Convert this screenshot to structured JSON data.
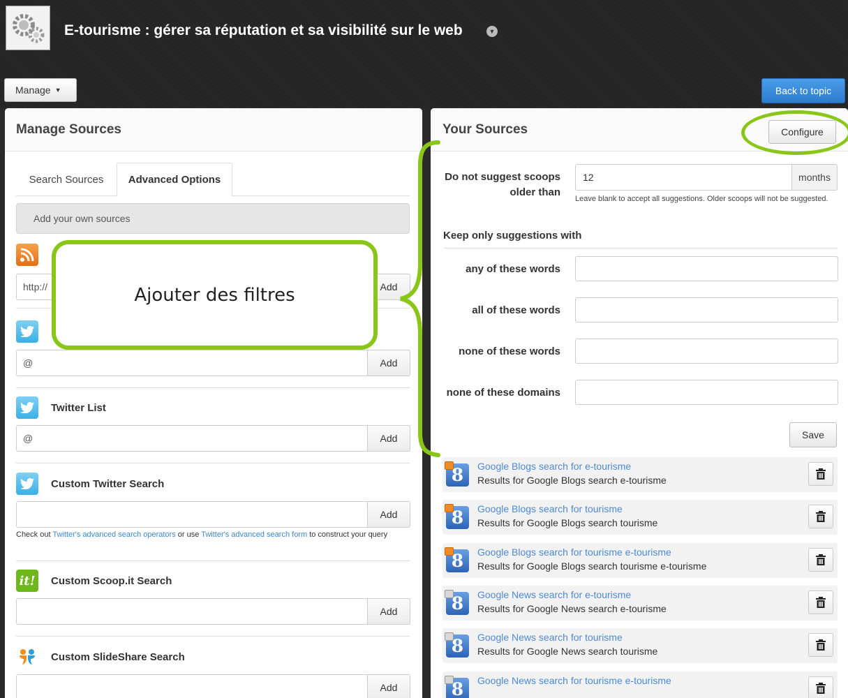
{
  "header": {
    "topic_title": "E-tourisme : gérer sa réputation et sa visibilité sur le web",
    "manage_label": "Manage",
    "back_label": "Back to topic"
  },
  "left_panel": {
    "title": "Manage Sources",
    "tabs": [
      "Search Sources",
      "Advanced Options"
    ],
    "own_sources_label": "Add your own sources",
    "add_label": "Add",
    "rss": {
      "icon": "rss-icon",
      "input_value": "http://"
    },
    "twitter_user": {
      "icon": "twitter-icon",
      "input_value": "@"
    },
    "twitter_list": {
      "icon": "twitter-icon",
      "label": "Twitter List",
      "input_value": "@"
    },
    "custom_twitter": {
      "icon": "twitter-icon",
      "label": "Custom Twitter Search",
      "help_prefix": "Check out ",
      "help_link1": "Twitter's advanced search operators",
      "help_mid": " or use ",
      "help_link2": "Twitter's advanced search form",
      "help_suffix": " to construct your query"
    },
    "custom_scoopit": {
      "icon": "scoopit-icon",
      "label": "Custom Scoop.it Search",
      "icon_text": "it!"
    },
    "custom_slideshare": {
      "icon": "slideshare-icon",
      "label": "Custom SlideShare Search"
    }
  },
  "callout": {
    "text": "Ajouter des filtres"
  },
  "right_panel": {
    "title": "Your Sources",
    "configure_label": "Configure",
    "scoops_label_line1": "Do not suggest scoops",
    "scoops_label_line2": "older than",
    "months_value": "12",
    "months_addon": "months",
    "months_help": "Leave blank to accept all suggestions. Older scoops will not be suggested.",
    "keep_title": "Keep only suggestions with",
    "filters": [
      {
        "label": "any of these words",
        "value": ""
      },
      {
        "label": "all of these words",
        "value": ""
      },
      {
        "label": "none of these words",
        "value": ""
      },
      {
        "label": "none of these domains",
        "value": ""
      }
    ],
    "save_label": "Save",
    "sources": [
      {
        "kind": "blog",
        "title": "Google Blogs search for e-tourisme",
        "subtitle": "Results for Google Blogs search e-tourisme"
      },
      {
        "kind": "blog",
        "title": "Google Blogs search for tourisme",
        "subtitle": "Results for Google Blogs search tourisme"
      },
      {
        "kind": "blog",
        "title": "Google Blogs search for tourisme e-tourisme",
        "subtitle": "Results for Google Blogs search tourisme e-tourisme"
      },
      {
        "kind": "news",
        "title": "Google News search for e-tourisme",
        "subtitle": "Results for Google News search e-tourisme"
      },
      {
        "kind": "news",
        "title": "Google News search for tourisme",
        "subtitle": "Results for Google News search tourisme"
      },
      {
        "kind": "news",
        "title": "Google News search for tourisme e-tourisme",
        "subtitle": ""
      }
    ]
  },
  "colors": {
    "annotation_green": "#8ac618",
    "primary_button": "#2b7ccf",
    "link": "#4d8ad4"
  }
}
